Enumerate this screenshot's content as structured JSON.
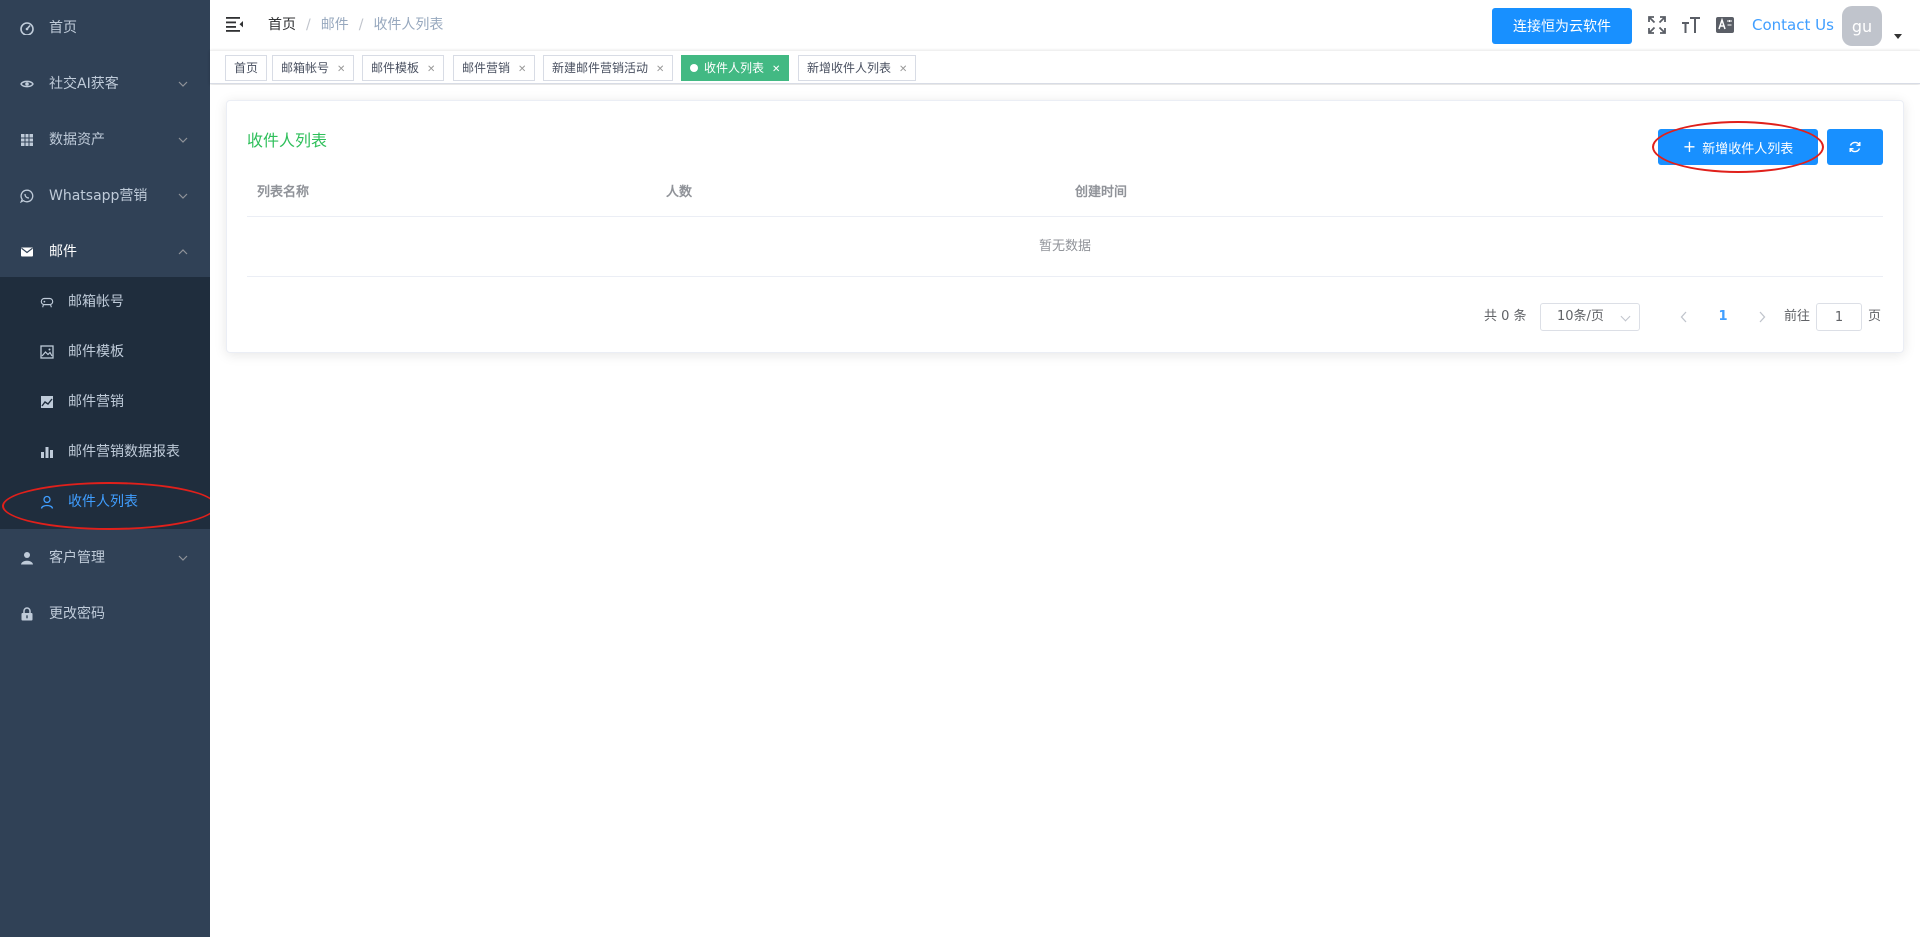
{
  "sidebar": {
    "items": [
      {
        "label": "首页",
        "icon": "dashboard-icon",
        "expandable": false
      },
      {
        "label": "社交AI获客",
        "icon": "eye-icon",
        "expandable": true
      },
      {
        "label": "数据资产",
        "icon": "table-icon",
        "expandable": true
      },
      {
        "label": "Whatsapp营销",
        "icon": "whatsapp-icon",
        "expandable": true
      },
      {
        "label": "邮件",
        "icon": "mail-icon",
        "expandable": true,
        "open": true
      },
      {
        "label": "客户管理",
        "icon": "user-icon",
        "expandable": true
      },
      {
        "label": "更改密码",
        "icon": "lock-icon",
        "expandable": false
      }
    ],
    "mail_submenu": [
      {
        "label": "邮箱帐号",
        "icon": "mailbox-icon"
      },
      {
        "label": "邮件模板",
        "icon": "image-icon"
      },
      {
        "label": "邮件营销",
        "icon": "chart-area-icon"
      },
      {
        "label": "邮件营销数据报表",
        "icon": "bar-chart-icon"
      },
      {
        "label": "收件人列表",
        "icon": "person-icon",
        "active": true
      }
    ]
  },
  "header": {
    "breadcrumb": [
      "首页",
      "邮件",
      "收件人列表"
    ],
    "connect_button": "连接恒为云软件",
    "contact": "Contact Us",
    "avatar_text": "gu",
    "icons": [
      "fullscreen-icon",
      "font-size-icon",
      "translate-icon"
    ]
  },
  "tags": [
    {
      "label": "首页",
      "closable": false
    },
    {
      "label": "邮箱帐号",
      "closable": true
    },
    {
      "label": "邮件模板",
      "closable": true
    },
    {
      "label": "邮件营销",
      "closable": true
    },
    {
      "label": "新建邮件营销活动",
      "closable": true
    },
    {
      "label": "收件人列表",
      "closable": true,
      "active": true
    },
    {
      "label": "新增收件人列表",
      "closable": true
    }
  ],
  "main": {
    "title": "收件人列表",
    "add_button": "新增收件人列表",
    "columns": [
      "列表名称",
      "人数",
      "创建时间"
    ],
    "empty_text": "暂无数据",
    "pagination": {
      "total": "共 0 条",
      "page_size": "10条/页",
      "current": "1",
      "goto_label": "前往",
      "goto_value": "1",
      "page_label": "页"
    }
  },
  "colors": {
    "sidebar_bg": "#304156",
    "submenu_bg": "#1f2d3d",
    "primary": "#1890ff",
    "active_tag": "#42b983",
    "title_green": "#2ebf5a",
    "annotation_red": "#e0201b"
  }
}
